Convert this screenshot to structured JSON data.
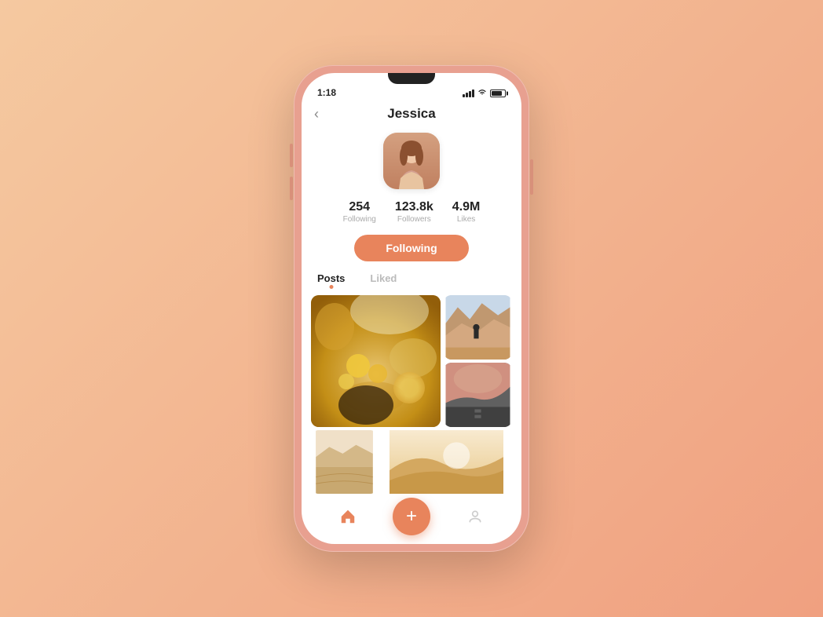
{
  "background": {
    "gradient_start": "#f5c9a0",
    "gradient_end": "#f0a080"
  },
  "phone": {
    "status_bar": {
      "time": "1:18",
      "battery_percent": 80
    },
    "header": {
      "back_label": "‹",
      "title": "Jessica"
    },
    "profile": {
      "avatar_alt": "Jessica profile photo",
      "stats": [
        {
          "value": "254",
          "label": "Following"
        },
        {
          "value": "123.8k",
          "label": "Followers"
        },
        {
          "value": "4.9M",
          "label": "Likes"
        }
      ],
      "follow_button": "Following"
    },
    "tabs": [
      {
        "id": "posts",
        "label": "Posts",
        "active": true
      },
      {
        "id": "liked",
        "label": "Liked",
        "active": false
      }
    ],
    "bottom_nav": {
      "add_button": "+",
      "home_label": "Home",
      "profile_label": "Profile"
    }
  }
}
